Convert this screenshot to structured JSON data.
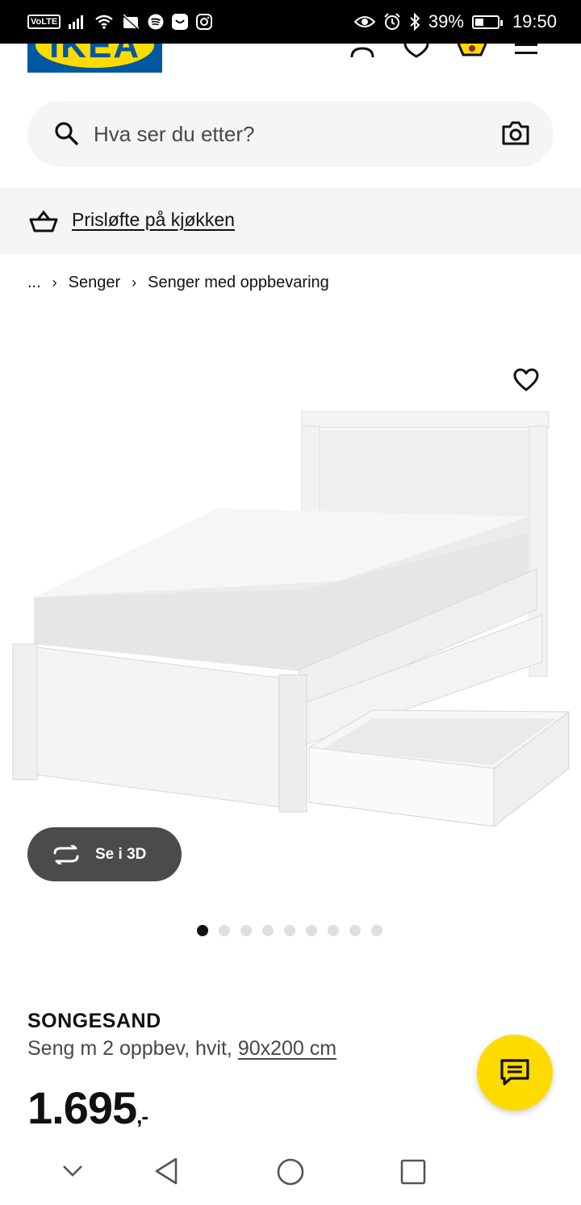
{
  "status_bar": {
    "network_badge": "VoLTE",
    "battery_percent": "39%",
    "battery_level": 0.39,
    "time": "19:50"
  },
  "header": {
    "logo_text": "IKEA",
    "icons": [
      "profile-icon",
      "heart-icon",
      "cart-icon",
      "menu-icon"
    ]
  },
  "search": {
    "placeholder": "Hva ser du etter?"
  },
  "promo": {
    "label": "Prisløfte på kjøkken"
  },
  "breadcrumb": {
    "items": [
      "...",
      "Senger",
      "Senger med oppbevaring"
    ]
  },
  "gallery": {
    "view_3d_label": "Se i 3D",
    "total_images": 9,
    "active_index": 0
  },
  "product": {
    "name": "SONGESAND",
    "description": "Seng m 2 oppbev, hvit,",
    "size": "90x200 cm",
    "price_main": "1.695",
    "price_suffix": ",-"
  },
  "colors": {
    "ikea_blue": "#0058a3",
    "ikea_yellow": "#ffdb00",
    "button_dark": "#4b4b4b"
  }
}
